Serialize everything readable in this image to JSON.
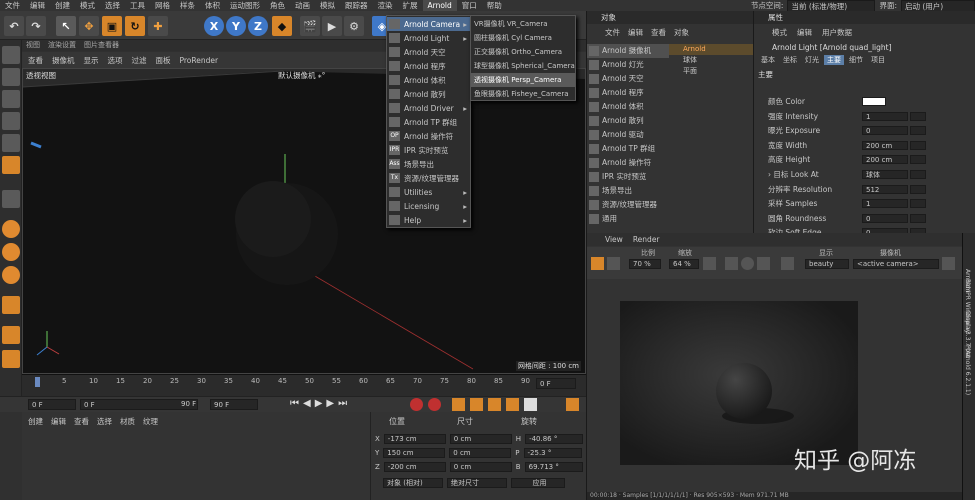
{
  "menubar": {
    "items": [
      "文件",
      "编辑",
      "创建",
      "模式",
      "选择",
      "工具",
      "网格",
      "样条",
      "体积",
      "运动图形",
      "角色",
      "动画",
      "模拟",
      "跟踪器",
      "渲染",
      "扩展",
      "Arnold",
      "窗口",
      "帮助"
    ],
    "active_index": 16,
    "node_space_label": "节点空间:",
    "node_space_value": "当前 (标准/物理)",
    "layout_label": "界面:",
    "layout_value": "启动 (用户)"
  },
  "toolbar": {
    "x_label": "X",
    "y_label": "Y",
    "z_label": "Z"
  },
  "viewport": {
    "tabs": [
      "视图",
      "渲染设置",
      "图片查看器"
    ],
    "menu": [
      "查看",
      "摄像机",
      "显示",
      "选项",
      "过滤",
      "面板",
      "ProRender"
    ],
    "label": "透视视图",
    "camera_label": "默认摄像机 ⁎°",
    "grid_label": "网格间距 : 100 cm"
  },
  "timeline": {
    "ticks": [
      "0",
      "5",
      "10",
      "15",
      "20",
      "25",
      "30",
      "35",
      "40",
      "45",
      "50",
      "55",
      "60",
      "65",
      "70",
      "75",
      "80",
      "85",
      "90"
    ],
    "current_frame": "0 F"
  },
  "transport": {
    "start": "0 F",
    "current": "0 F",
    "end": "90 F",
    "max": "90 F"
  },
  "bottom": {
    "menu": [
      "创建",
      "编辑",
      "查看",
      "选择",
      "材质",
      "纹理"
    ]
  },
  "coords": {
    "headers": [
      "位置",
      "尺寸",
      "旋转"
    ],
    "rows": [
      {
        "axis": "X",
        "pos": "-173 cm",
        "size": "0 cm",
        "rot_axis": "H",
        "rot": "-40.86 °"
      },
      {
        "axis": "Y",
        "pos": "150 cm",
        "size": "0 cm",
        "rot_axis": "P",
        "rot": "-25.3 °"
      },
      {
        "axis": "Z",
        "pos": "-200 cm",
        "size": "0 cm",
        "rot_axis": "B",
        "rot": "69.713 °"
      }
    ],
    "mode1": "对象 (相对)",
    "mode2": "绝对尺寸",
    "apply": "应用"
  },
  "arnold_menu": {
    "items": [
      {
        "icon": "",
        "label": "Arnold Camera",
        "arrow": "▸"
      },
      {
        "icon": "",
        "label": "Arnold Light",
        "arrow": "▸"
      },
      {
        "icon": "",
        "label": "Arnold 天空",
        "arrow": ""
      },
      {
        "icon": "",
        "label": "Arnold 程序",
        "arrow": ""
      },
      {
        "icon": "",
        "label": "Arnold 体积",
        "arrow": ""
      },
      {
        "icon": "",
        "label": "Arnold 散列",
        "arrow": ""
      },
      {
        "icon": "",
        "label": "Arnold Driver",
        "arrow": "▸"
      },
      {
        "icon": "",
        "label": "Arnold TP 群组",
        "arrow": ""
      },
      {
        "icon": "OP",
        "label": "Arnold 操作符",
        "arrow": ""
      },
      {
        "icon": "IPR",
        "label": "IPR 实时预览",
        "arrow": ""
      },
      {
        "icon": "Ass",
        "label": "场景导出",
        "arrow": ""
      },
      {
        "icon": "Tx",
        "label": "资源/纹理管理器",
        "arrow": ""
      },
      {
        "icon": "",
        "label": "Utilities",
        "arrow": "▸"
      },
      {
        "icon": "",
        "label": "Licensing",
        "arrow": "▸"
      },
      {
        "icon": "",
        "label": "Help",
        "arrow": "▸"
      }
    ],
    "highlight_index": 0
  },
  "camera_submenu": {
    "items": [
      "VR摄像机 VR_Camera",
      "圆柱摄像机 Cyl Camera",
      "正交摄像机 Ortho_Camera",
      "球型摄像机 Spherical_Camera",
      "透视摄像机 Persp_Camera",
      "鱼眼摄像机 Fisheye_Camera"
    ],
    "highlight_index": 4
  },
  "objects": {
    "title": "对象",
    "menu": [
      "文件",
      "编辑",
      "查看",
      "对象"
    ],
    "list": [
      "Arnold 摄像机",
      "Arnold 灯光",
      "Arnold 天空",
      "Arnold 程序",
      "Arnold 体积",
      "Arnold 散列",
      "Arnold 驱动",
      "Arnold TP 群组",
      "Arnold 操作符",
      "IPR 实时预览",
      "场景导出",
      "资源/纹理管理器",
      "通用"
    ],
    "tree": [
      "Arnold",
      "球体",
      "平面"
    ]
  },
  "attributes": {
    "title": "属性",
    "menu": [
      "模式",
      "编辑",
      "用户数据"
    ],
    "object_title": "Arnold Light [Arnold quad_light]",
    "tabs": [
      "基本",
      "坐标",
      "灯光",
      "主要",
      "细节",
      "项目"
    ],
    "active_tab": 3,
    "section": "主要",
    "rows": [
      {
        "label": "颜色 Color",
        "value": ""
      },
      {
        "label": "强度 Intensity",
        "value": "1"
      },
      {
        "label": "曝光 Exposure",
        "value": "0"
      },
      {
        "label": "宽度 Width",
        "value": "200 cm"
      },
      {
        "label": "高度 Height",
        "value": "200 cm"
      },
      {
        "label": "› 目标 Look At",
        "value": "球体"
      },
      {
        "label": "分辨率 Resolution",
        "value": "512"
      },
      {
        "label": "采样 Samples",
        "value": "1"
      },
      {
        "label": "圆角 Roundness",
        "value": "0"
      },
      {
        "label": "软边 Soft Edge",
        "value": "0"
      }
    ],
    "color_swatch": "#ffffff"
  },
  "ipr": {
    "menu": [
      "View",
      "Render"
    ],
    "ratio_label": "比例",
    "zoom_label": "缩放",
    "display_label": "显示",
    "camera_label": "摄像机",
    "ratio": "70 %",
    "zoom": "64 %",
    "display": "beauty",
    "camera": "<active camera>",
    "status": "00:00:18 · Samples [1/1/1/1/1/1] · Res 905×593 · Mem 971.71 MB",
    "side_title": "Arnold IPR Window v3.3.7 (Arnold 6.2.1.1)",
    "side_tabs": [
      "Rem",
      "Display",
      "Post"
    ]
  },
  "watermark": "知乎 @阿冻"
}
